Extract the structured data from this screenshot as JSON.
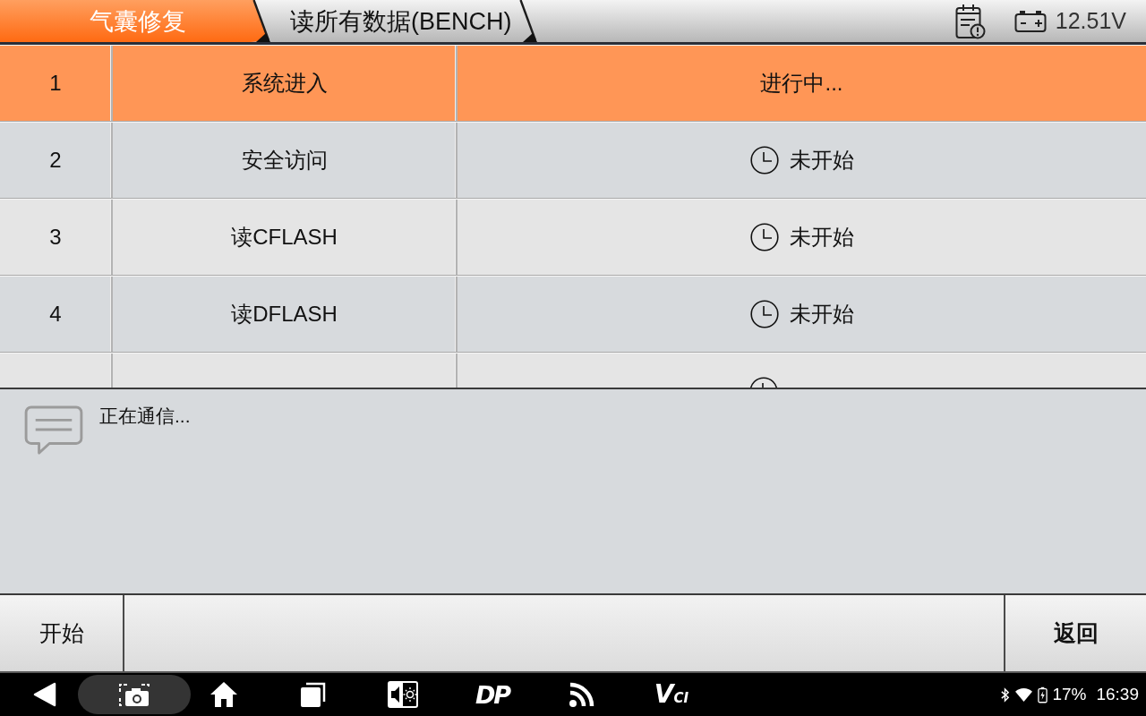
{
  "tabs": [
    {
      "label": "气囊修复",
      "selected": true
    },
    {
      "label": "读所有数据(BENCH)",
      "selected": false
    }
  ],
  "header_status": {
    "voltage": "12.51V"
  },
  "table": {
    "rows": [
      {
        "number": "1",
        "step": "系统进入",
        "status": "进行中...",
        "pending": false,
        "selected": true
      },
      {
        "number": "2",
        "step": "安全访问",
        "status": "未开始",
        "pending": true,
        "selected": false
      },
      {
        "number": "3",
        "step": "读CFLASH",
        "status": "未开始",
        "pending": true,
        "selected": false
      },
      {
        "number": "4",
        "step": "读DFLASH",
        "status": "未开始",
        "pending": true,
        "selected": false
      },
      {
        "pending": true,
        "selected": false
      }
    ]
  },
  "message": {
    "text": "正在通信..."
  },
  "bottom_bar": {
    "left": [
      {
        "label": "开始",
        "emphasized": false
      }
    ],
    "right": [
      {
        "label": "返回",
        "emphasized": true
      }
    ]
  },
  "nav_bar": {
    "dp_logo": "DP",
    "vci_logo": "VCI"
  },
  "status_bar": {
    "battery": "17%",
    "time": "16:39"
  }
}
